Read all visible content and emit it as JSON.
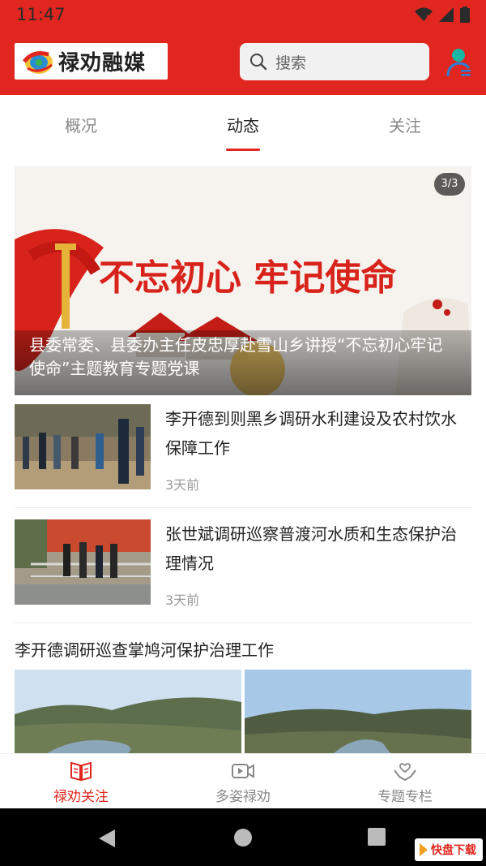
{
  "status_bar": {
    "time": "11:47"
  },
  "header": {
    "logo_text": "禄劝融媒",
    "search_placeholder": "搜索"
  },
  "tabs": [
    {
      "label": "概况",
      "active": false
    },
    {
      "label": "动态",
      "active": true
    },
    {
      "label": "关注",
      "active": false
    }
  ],
  "banner": {
    "counter": "3/3",
    "image_text": "不忘初心 牢记使命",
    "caption": "县委常委、县委办主任皮忠厚赴雪山乡讲授“不忘初心牢记使命”主题教育专题党课"
  },
  "news": [
    {
      "title": "李开德到则黑乡调研水利建设及农村饮水保障工作",
      "time": "3天前"
    },
    {
      "title": "张世斌调研巡察普渡河水质和生态保护治理情况",
      "time": "3天前"
    }
  ],
  "gallery": {
    "title": "李开德调研巡查掌鸠河保护治理工作"
  },
  "bottom_nav": [
    {
      "label": "禄劝关注",
      "icon": "book-icon",
      "active": true
    },
    {
      "label": "多姿禄劝",
      "icon": "video-icon",
      "active": false
    },
    {
      "label": "专题专栏",
      "icon": "hands-icon",
      "active": false
    }
  ],
  "watermark": {
    "text": "快盘下载"
  },
  "colors": {
    "brand_red": "#e0261e",
    "accent_teal": "#19b5a5"
  }
}
